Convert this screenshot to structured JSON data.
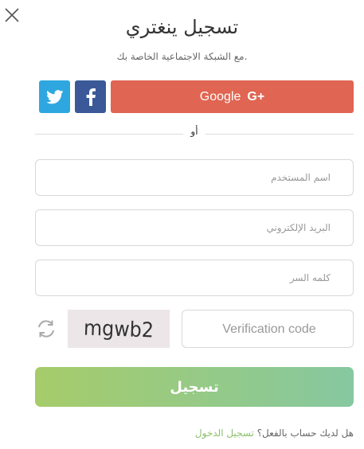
{
  "header": {
    "close_icon": "close-icon",
    "title": "تسجيل ينغتري",
    "subtitle": "مع الشبكة الاجتماعية الخاصة بك."
  },
  "social": {
    "twitter_icon": "twitter-bird-icon",
    "facebook_icon": "facebook-f-icon",
    "google_label": "Google",
    "google_plus": "G+",
    "colors": {
      "twitter": "#2ea7e0",
      "facebook": "#3b5998",
      "google": "#e06552"
    }
  },
  "divider": {
    "label": "أو"
  },
  "form": {
    "username_placeholder": "اسم المستخدم",
    "email_placeholder": "البريد الإلكتروني",
    "password_placeholder": "كلمه السر",
    "refresh_icon": "refresh-icon",
    "captcha_text": "mgwb2",
    "verification_placeholder": "Verification code",
    "submit_label": "تسجيل",
    "submit_colors": [
      "#a6cc6a",
      "#86c8a0"
    ]
  },
  "footer": {
    "question": "هل لديك حساب بالفعل؟",
    "login_link": "تسجيل الدخول",
    "link_color": "#8cc06a"
  }
}
